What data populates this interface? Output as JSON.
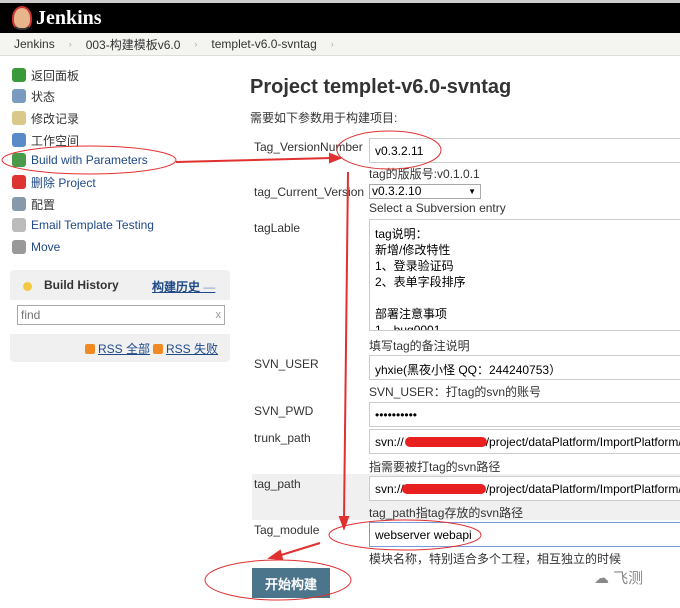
{
  "header": {
    "app_name": "Jenkins"
  },
  "breadcrumb": [
    "Jenkins",
    "003-构建模板v6.0",
    "templet-v6.0-svntag"
  ],
  "sidebar": {
    "items": [
      {
        "label": "返回面板",
        "icon": "up-arrow-icon",
        "color": "#3a9a3a"
      },
      {
        "label": "状态",
        "icon": "search-icon",
        "color": "#7a9ac0"
      },
      {
        "label": "修改记录",
        "icon": "notepad-icon",
        "color": "#d9c88a"
      },
      {
        "label": "工作空间",
        "icon": "folder-icon",
        "color": "#5a8ac8"
      },
      {
        "label": "Build with Parameters",
        "icon": "build-clock-icon",
        "color": "#4a9a4a"
      },
      {
        "label": "删除 Project",
        "icon": "no-entry-icon",
        "color": "#d33"
      },
      {
        "label": "配置",
        "icon": "gear-icon",
        "color": "#8899aa"
      },
      {
        "label": "Email Template Testing",
        "icon": "email-icon",
        "color": "#bbb"
      },
      {
        "label": "Move",
        "icon": "move-icon",
        "color": "#999"
      }
    ]
  },
  "build_history": {
    "title": "Build History",
    "link": "构建历史",
    "trend": "—",
    "search_placeholder": "find",
    "clear": "x",
    "rss_all": "RSS 全部",
    "rss_failed": "RSS 失败"
  },
  "main": {
    "title": "Project templet-v6.0-svntag",
    "intro": "需要如下参数用于构建项目:",
    "params": {
      "version": {
        "label": "Tag_VersionNumber",
        "value": "v0.3.2.11",
        "desc": "tag的版版号:v0.1.0.1"
      },
      "current": {
        "label": "tag_Current_Version",
        "value": "v0.3.2.10",
        "desc": "Select a Subversion entry"
      },
      "lable": {
        "label": "tagLable",
        "value": "tag说明：\n新增/修改特性\n1、登录验证码\n2、表单字段排序\n\n部署注意事项\n1、bug0001",
        "desc": "填写tag的备注说明"
      },
      "user": {
        "label": "SVN_USER",
        "value": "yhxie(黑夜小怪 QQ：244240753）",
        "desc": "SVN_USER：打tag的svn的账号"
      },
      "pwd": {
        "label": "SVN_PWD",
        "value": "••••••••••"
      },
      "trunk": {
        "label": "trunk_path",
        "value_prefix": "svn://",
        "value_suffix": "/project/dataPlatform/ImportPlatform/",
        "desc": "指需要被打tag的svn路径"
      },
      "tagpath": {
        "label": "tag_path",
        "value_prefix": "svn://",
        "value_suffix": "/project/dataPlatform/ImportPlatform/",
        "desc": "tag_path指tag存放的svn路径"
      },
      "module": {
        "label": "Tag_module",
        "value": "webserver webapi",
        "desc": "模块名称，特别适合多个工程，相互独立的时候"
      }
    },
    "build_button": "开始构建"
  },
  "watermark": "飞测",
  "colors": {
    "annotation": "#e03030",
    "button": "#4b758b"
  }
}
